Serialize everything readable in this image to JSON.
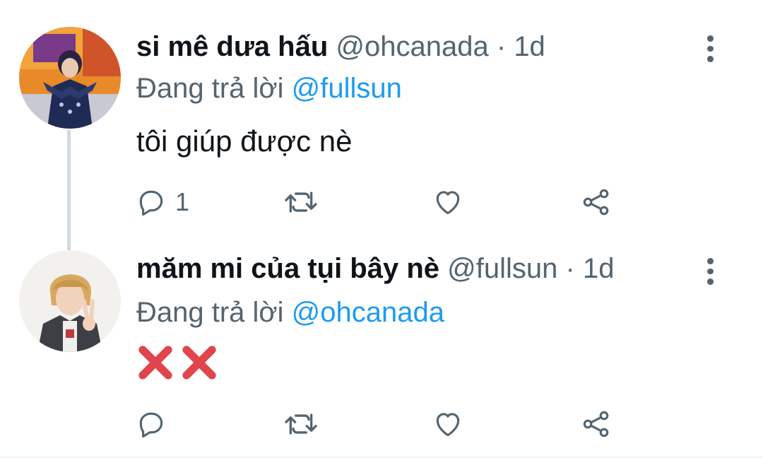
{
  "tweets": [
    {
      "display_name": "si mê dưa hấu",
      "handle": "@ohcanada",
      "separator": "·",
      "time": "1d",
      "replying_prefix": "Đang trả lời",
      "replying_to": "@fullsun",
      "text": "tôi giúp được nè",
      "reply_count": "1"
    },
    {
      "display_name": "măm mi của tụi bây nè",
      "handle": "@fullsun",
      "separator": "·",
      "time": "1d",
      "replying_prefix": "Đang trả lời",
      "replying_to": "@ohcanada",
      "text": "❌❌",
      "reply_count": ""
    }
  ],
  "icons": {
    "reply": "reply-icon",
    "retweet": "retweet-icon",
    "like": "heart-icon",
    "share": "share-icon",
    "more": "more-vertical-icon",
    "cross": "cross-mark-emoji"
  },
  "colors": {
    "mention": "#1d9bf0",
    "secondary_text": "#536471",
    "thread_line": "#cfd9de",
    "cross": "#e0454d"
  }
}
